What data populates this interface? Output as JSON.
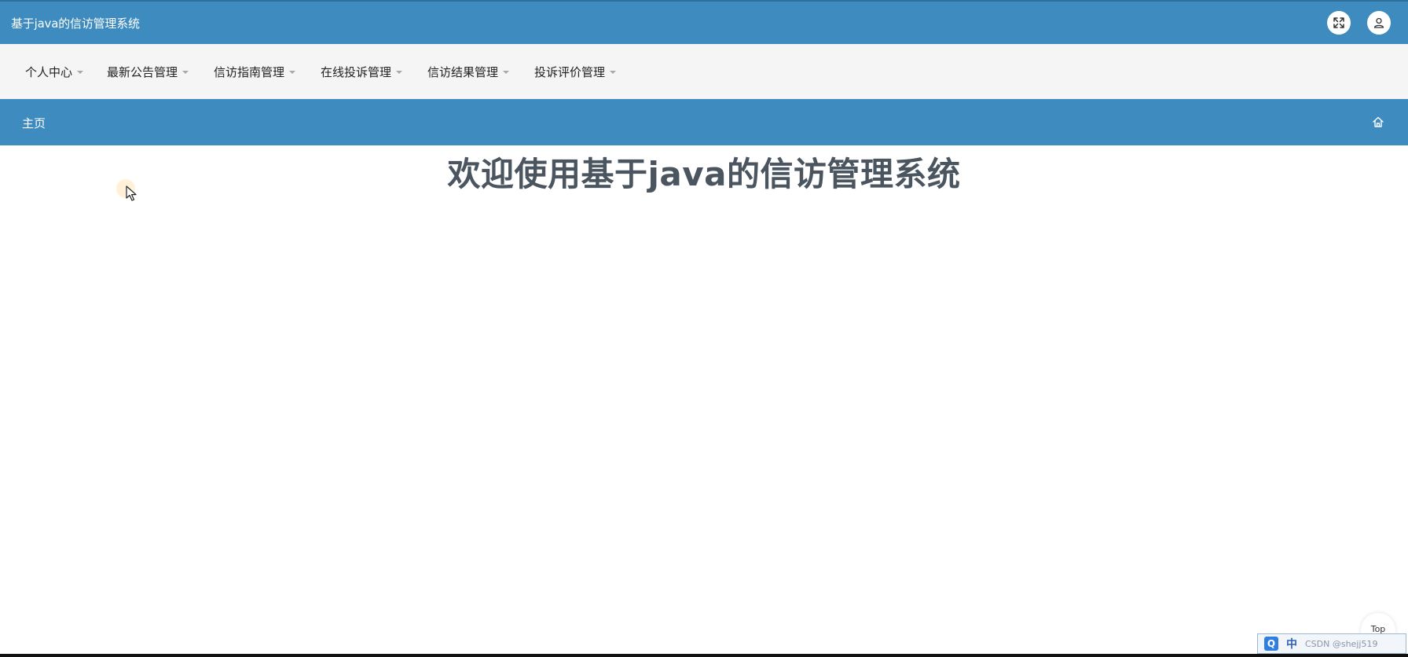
{
  "app": {
    "title": "基于java的信访管理系统"
  },
  "topbar": {
    "fullscreen_icon": "fullscreen-toggle-icon",
    "user_icon": "user-icon"
  },
  "nav": {
    "items": [
      {
        "label": "个人中心"
      },
      {
        "label": "最新公告管理"
      },
      {
        "label": "信访指南管理"
      },
      {
        "label": "在线投诉管理"
      },
      {
        "label": "信访结果管理"
      },
      {
        "label": "投诉评价管理"
      }
    ]
  },
  "breadcrumb": {
    "home_label": "主页",
    "home_icon": "home-icon"
  },
  "main": {
    "welcome_text": "欢迎使用基于java的信访管理系统"
  },
  "back_to_top": {
    "label": "Top"
  },
  "ime": {
    "logo": "Q",
    "mode": "中",
    "watermark": "CSDN @shejj519"
  },
  "colors": {
    "primary": "#3d8bbf",
    "navbar_bg": "#f5f5f5",
    "heading": "#4a5560"
  }
}
